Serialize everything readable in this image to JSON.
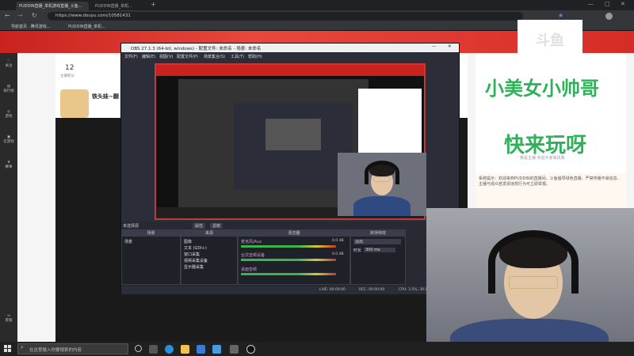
{
  "browser": {
    "tabs": [
      {
        "label": "PUDDIN直播_单机游戏直播_斗鱼..."
      },
      {
        "label": "PUDDIN直播_单机..."
      }
    ],
    "url": "https://www.douyu.com/10581431",
    "bookmarks": [
      "导航首页 · 腾讯游戏...",
      "PUDDIN直播_单机..."
    ]
  },
  "douyu": {
    "follow_count": "12",
    "follow_label": "主播积分",
    "room_name": "铁头娃~翻",
    "rail": [
      "关注",
      "排行榜",
      "游戏",
      "云游戏",
      "赛事",
      "客服"
    ],
    "chat_text": "系统提示：欢迎来到PUDDIN的直播间。斗鱼倡导绿色直播，严禁传播不良信息、主播与观众若发现违规行为可立即举报。"
  },
  "obs": {
    "title": "OBS 27.1.3 (64-bit, windows) - 配置文件: 未命名 - 场景: 未命名",
    "menu": [
      "文件(F)",
      "编辑(E)",
      "视图(V)",
      "配置文件(P)",
      "场景集合(S)",
      "工具(T)",
      "帮助(H)"
    ],
    "no_source": "未选择源",
    "btn_props": "属性",
    "btn_filters": "滤镜",
    "docks": {
      "scenes": {
        "title": "场景",
        "items": [
          "场景"
        ]
      },
      "sources": {
        "title": "来源",
        "items": [
          "图像",
          "文本 (GDI+)",
          "窗口采集",
          "视频采集设备",
          "显示器采集"
        ]
      },
      "mixer": {
        "title": "混音器",
        "items": [
          "麦克风/Aux",
          "台式音频设备",
          "桌面音频"
        ],
        "level": "0.0 dB"
      },
      "transitions": {
        "title": "转场特效",
        "type": "淡出",
        "duration_label": "时长",
        "duration": "300 ms"
      }
    },
    "status": {
      "live": "LIVE: 00:00:00",
      "rec": "REC: 00:00:00",
      "cpu": "CPU: 3.5%, 30.00 fps"
    }
  },
  "overlay": {
    "line1": "小美女小帅哥",
    "line2": "快来玩呀",
    "sub": "我是主播 欢迎大家来找我",
    "logo": "斗鱼"
  },
  "taskbar": {
    "search_placeholder": "在这里输入你要搜索的内容"
  },
  "colors": {
    "brand_red": "#d62c27",
    "overlay_green": "#2fb15a",
    "obs_bg": "#2b2e38"
  }
}
